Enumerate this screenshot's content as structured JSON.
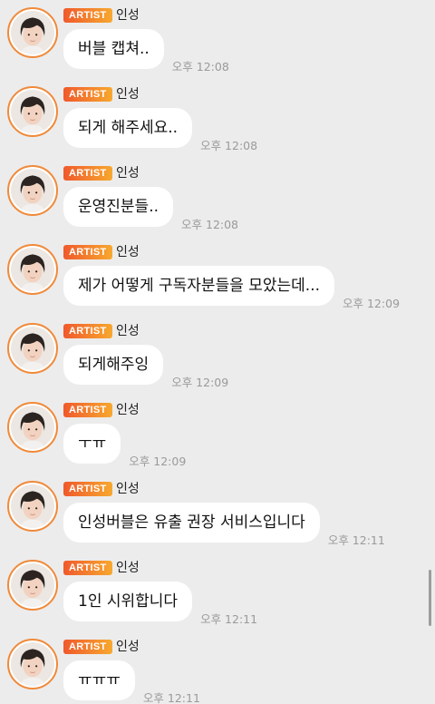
{
  "artist_tag": "ARTIST",
  "sender": "인성",
  "messages": [
    {
      "text": "버블 캡쳐..",
      "time": "오후 12:08"
    },
    {
      "text": "되게 해주세요..",
      "time": "오후 12:08"
    },
    {
      "text": "운영진분들..",
      "time": "오후 12:08"
    },
    {
      "text": "제가 어떻게 구독자분들을 모았는데...",
      "time": "오후 12:09"
    },
    {
      "text": "되게해주잉",
      "time": "오후 12:09"
    },
    {
      "text": "ㅜㅠ",
      "time": "오후 12:09"
    },
    {
      "text": "인성버블은 유출 권장 서비스입니다",
      "time": "오후 12:11"
    },
    {
      "text": "1인 시위합니다",
      "time": "오후 12:11"
    },
    {
      "text": "ㅠㅠㅠ",
      "time": "오후 12:11"
    }
  ],
  "icons": {
    "avatar": "artist-profile-photo"
  },
  "colors": {
    "background": "#ececec",
    "bubble": "#ffffff",
    "tag_gradient_start": "#f0592c",
    "tag_gradient_end": "#f7a82f",
    "avatar_ring": "#f08a3a",
    "timestamp": "#9a9a9a"
  }
}
